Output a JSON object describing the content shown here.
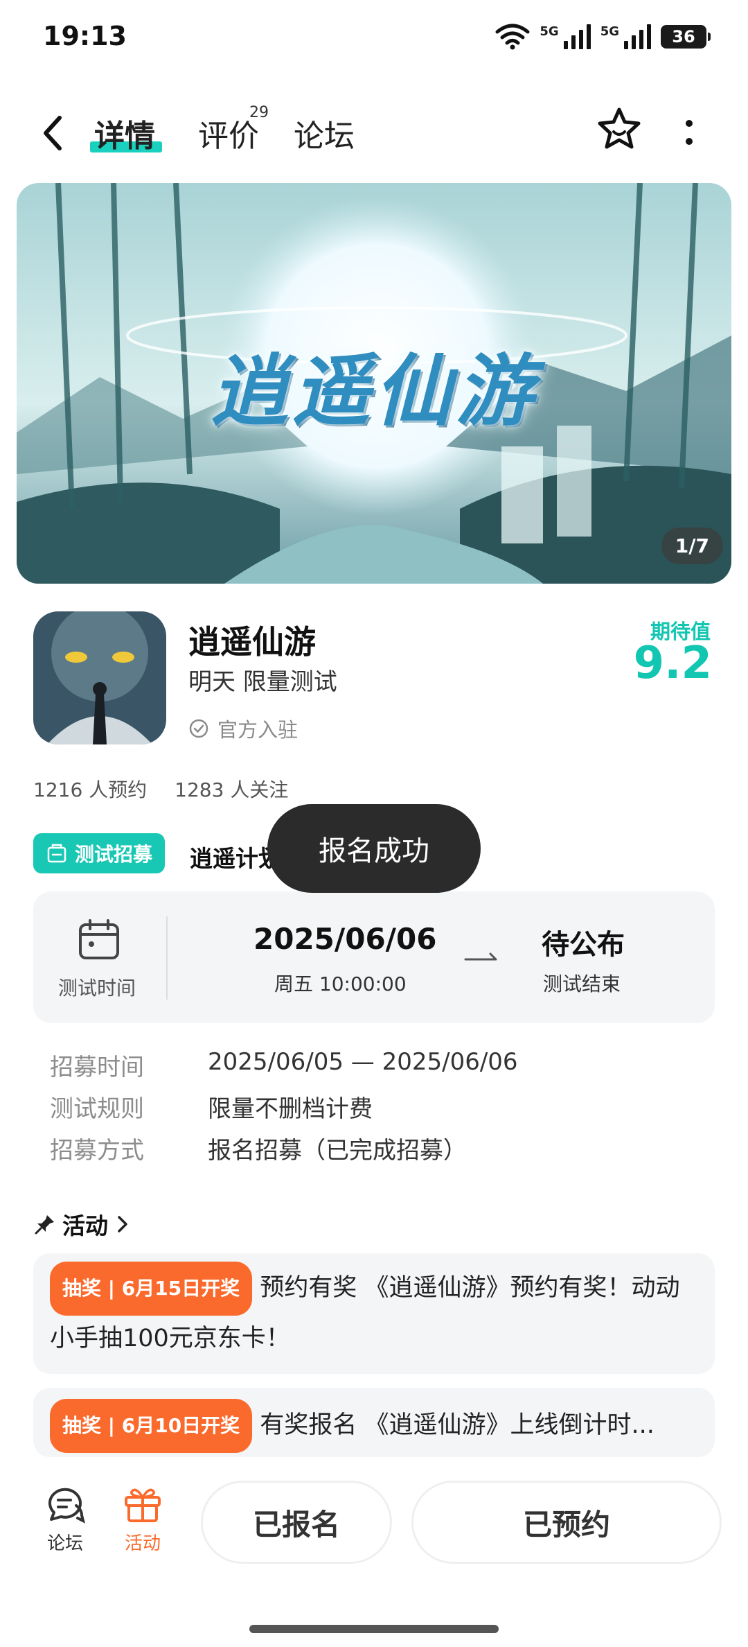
{
  "status_bar": {
    "time": "19:13",
    "net1": "5G",
    "net2": "5G",
    "battery": "36"
  },
  "nav": {
    "tab_detail": "详情",
    "tab_review": "评价",
    "review_count": "29",
    "tab_forum": "论坛"
  },
  "banner": {
    "title": "逍遥仙游",
    "counter": "1/7"
  },
  "game": {
    "name": "逍遥仙游",
    "subtitle": "明天 限量测试",
    "official": "官方入驻",
    "score_label": "期待值",
    "score_value": "9.2",
    "reservations": "1216 人预约",
    "followers": "1283 人关注"
  },
  "recruit": {
    "badge": "测试招募",
    "title": "逍遥计划",
    "toast": "报名成功",
    "time_label": "测试时间",
    "start_date": "2025/06/06",
    "start_time": "周五  10:00:00",
    "end_status": "待公布",
    "end_label": "测试结束",
    "rows": [
      {
        "key": "招募时间",
        "value": "2025/06/05 — 2025/06/06"
      },
      {
        "key": "测试规则",
        "value": "限量不删档计费"
      },
      {
        "key": "招募方式",
        "value": "报名招募（已完成招募）"
      }
    ]
  },
  "activities": {
    "header": "活动",
    "items": [
      {
        "tag": "抽奖 | 6月15日开奖",
        "text": "预约有奖 《逍遥仙游》预约有奖！动动小手抽100元京东卡！"
      },
      {
        "tag": "抽奖 | 6月10日开奖",
        "text": "有奖报名 《逍遥仙游》上线倒计时..."
      }
    ]
  },
  "bottom_bar": {
    "forum_label": "论坛",
    "activity_label": "活动",
    "registered_button": "已报名",
    "reserved_button": "已预约"
  },
  "colors": {
    "accent": "#19c8b4",
    "orange": "#fb6a2d"
  }
}
